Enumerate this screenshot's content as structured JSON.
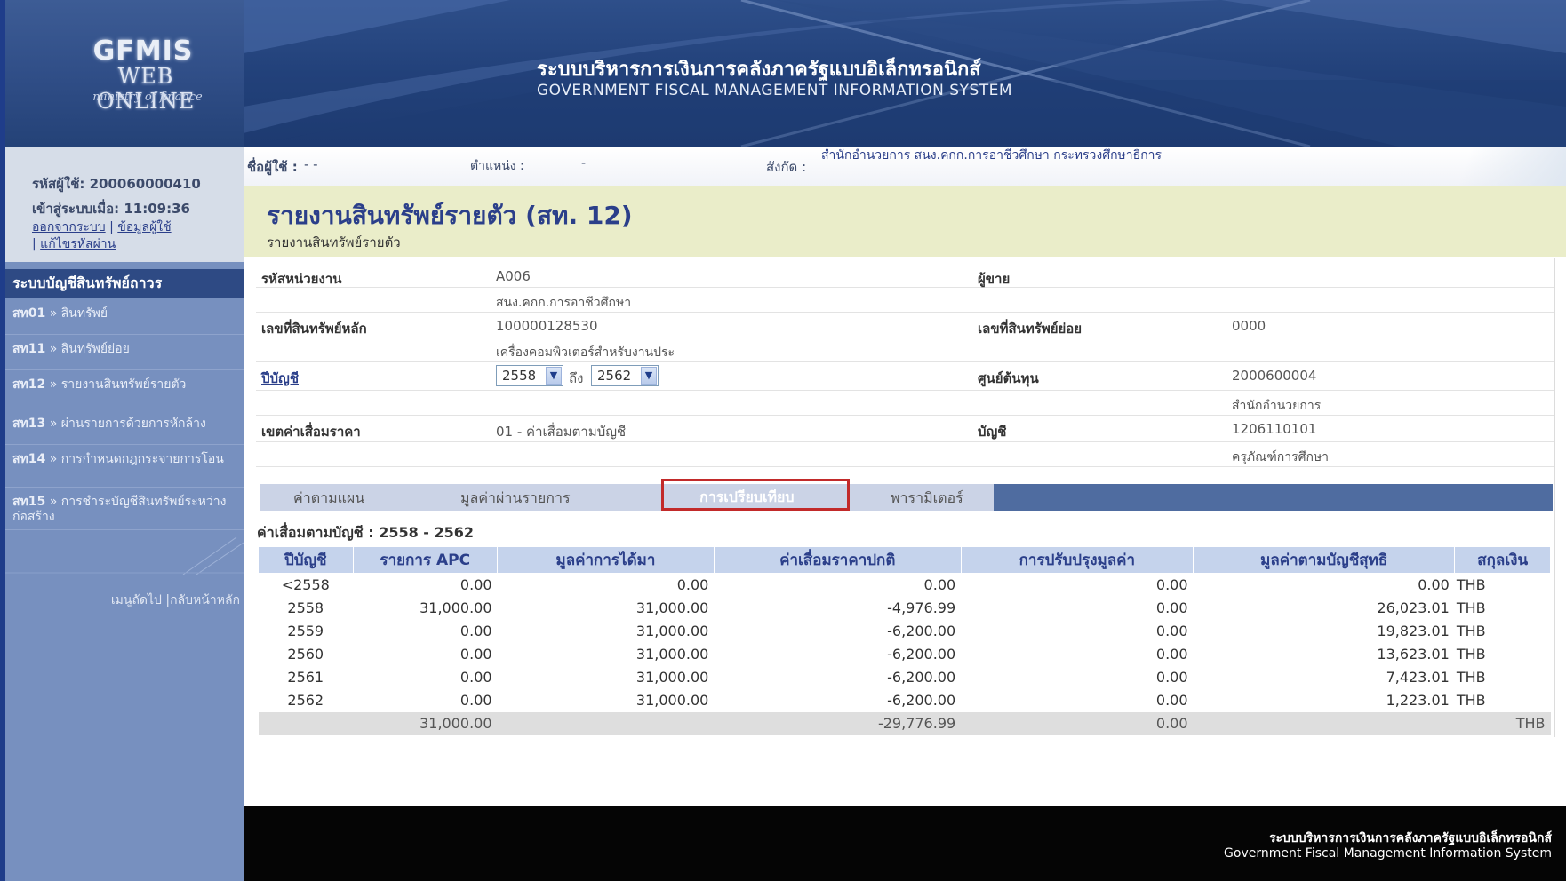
{
  "header": {
    "logo_line1": "GFMIS",
    "logo_line2": "WEB ONLINE",
    "logo_line3": "ministry of finance",
    "title_th": "ระบบบริหารการเงินการคลังภาครัฐแบบอิเล็กทรอนิกส์",
    "title_en": "GOVERNMENT FISCAL MANAGEMENT INFORMATION SYSTEM"
  },
  "sidebar": {
    "user_id_label": "รหัสผู้ใช้: 200060000410",
    "login_label": "เข้าสู่ระบบเมื่อ: 11:09:36",
    "logout_link": "ออกจากระบบ",
    "profile_link": "ข้อมูลผู้ใช้",
    "change_password_link": "แก้ไขรหัสผ่าน",
    "menu_title": "ระบบบัญชีสินทรัพย์ถาวร",
    "menu_items": [
      {
        "code": "สท01",
        "label": "สินทรัพย์"
      },
      {
        "code": "สท11",
        "label": "สินทรัพย์ย่อย"
      },
      {
        "code": "สท12",
        "label": "รายงานสินทรัพย์รายตัว"
      },
      {
        "code": "สท13",
        "label": "ผ่านรายการด้วยการหักล้าง"
      },
      {
        "code": "สท14",
        "label": "การกำหนดกฎกระจายการโอน"
      },
      {
        "code": "สท15",
        "label": "การชำระบัญชีสินทรัพย์ระหว่างก่อสร้าง"
      }
    ],
    "bottom_links": "เมนูถัดไป |กลับหน้าหลัก"
  },
  "info_bar": {
    "user_name_label": "ชื่อผู้ใช้ :",
    "user_name_value": "- -",
    "position_label": "ตำแหน่ง :",
    "position_value": "-",
    "org_label": "สังกัด :",
    "org_value": "สำนักอำนวยการ สนง.คกก.การอาชีวศึกษา กระทรวงศึกษาธิการ"
  },
  "page": {
    "title": "รายงานสินทรัพย์รายตัว (สท. 12)",
    "subtitle": "รายงานสินทรัพย์รายตัว"
  },
  "form": {
    "unit_code_label": "รหัสหน่วยงาน",
    "unit_code_value": "A006",
    "unit_name_value": "สนง.คกก.การอาชีวศึกษา",
    "seller_label": "ผู้ขาย",
    "main_asset_label": "เลขที่สินทรัพย์หลัก",
    "main_asset_value": "100000128530",
    "main_asset_desc": "เครื่องคอมพิวเตอร์สำหรับงานประ",
    "sub_asset_label": "เลขที่สินทรัพย์ย่อย",
    "sub_asset_value": "0000",
    "fiscal_year_label": "ปีบัญชี",
    "fiscal_year_from": "2558",
    "fiscal_year_to_label": "ถึง",
    "fiscal_year_to": "2562",
    "cost_center_label": "ศูนย์ต้นทุน",
    "cost_center_value": "2000600004",
    "cost_center_name": "สำนักอำนวยการ",
    "depreciation_area_label": "เขตค่าเสื่อมราคา",
    "depreciation_area_value": "01 - ค่าเสื่อมตามบัญชี",
    "account_label": "บัญชี",
    "account_value": "1206110101",
    "account_name": "ครุภัณฑ์การศึกษา"
  },
  "tabs": {
    "plan": "ค่าตามแผน",
    "value_transactions": "มูลค่าผ่านรายการ",
    "comparison": "การเปรียบเทียบ",
    "parameters": "พารามิเตอร์"
  },
  "section_heading": "ค่าเสื่อมตามบัญชี : 2558 - 2562",
  "table": {
    "headers": [
      "ปีบัญชี",
      "รายการ APC",
      "มูลค่าการได้มา",
      "ค่าเสื่อมราคาปกติ",
      "การปรับปรุงมูลค่า",
      "มูลค่าตามบัญชีสุทธิ",
      "สกุลเงิน"
    ],
    "rows": [
      [
        "<2558",
        "0.00",
        "0.00",
        "0.00",
        "0.00",
        "0.00",
        "THB"
      ],
      [
        "2558",
        "31,000.00",
        "31,000.00",
        "-4,976.99",
        "0.00",
        "26,023.01",
        "THB"
      ],
      [
        "2559",
        "0.00",
        "31,000.00",
        "-6,200.00",
        "0.00",
        "19,823.01",
        "THB"
      ],
      [
        "2560",
        "0.00",
        "31,000.00",
        "-6,200.00",
        "0.00",
        "13,623.01",
        "THB"
      ],
      [
        "2561",
        "0.00",
        "31,000.00",
        "-6,200.00",
        "0.00",
        "7,423.01",
        "THB"
      ],
      [
        "2562",
        "0.00",
        "31,000.00",
        "-6,200.00",
        "0.00",
        "1,223.01",
        "THB"
      ]
    ],
    "total": [
      "",
      "31,000.00",
      "",
      "-29,776.99",
      "0.00",
      "",
      "THB"
    ]
  },
  "footer": {
    "title_th": "ระบบบริหารการเงินการคลังภาครัฐแบบอิเล็กทรอนิกส์",
    "title_en": "Government Fiscal Management Information System"
  },
  "colors": {
    "frame_blue": "#1f3d8a",
    "sidebar_blue": "#7790bf",
    "title_bg": "#eaedc9",
    "table_header_bg": "#c5d3ec",
    "highlight_red": "#c22a2a"
  }
}
